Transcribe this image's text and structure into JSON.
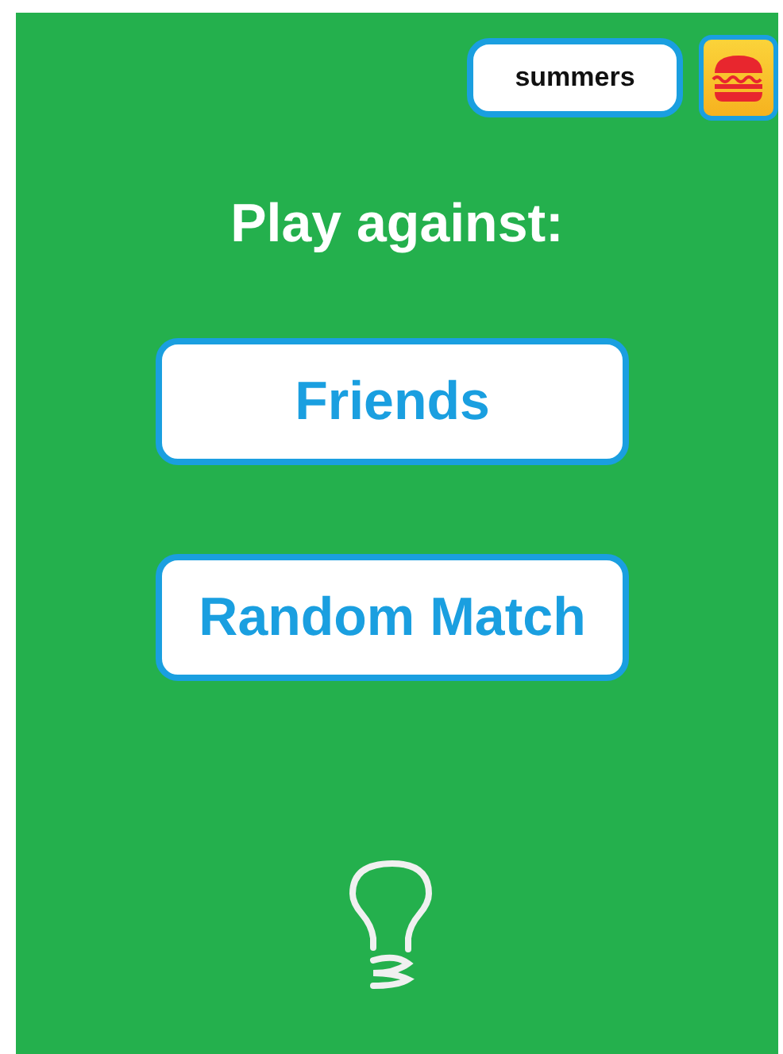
{
  "user": {
    "name": "summers"
  },
  "heading": "Play against:",
  "options": [
    {
      "label": "Friends"
    },
    {
      "label": "Random Match"
    }
  ]
}
